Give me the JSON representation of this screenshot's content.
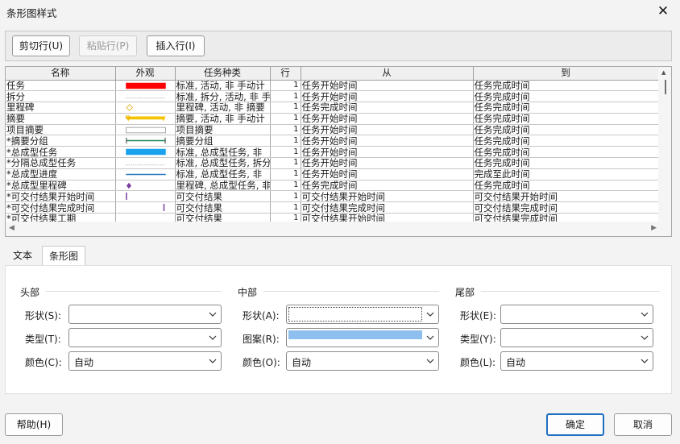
{
  "window": {
    "title": "条形图样式",
    "close_label": "✕"
  },
  "toolbar": {
    "cut_label": "剪切行(U)",
    "paste_label": "粘贴行(P)",
    "insert_label": "插入行(I)"
  },
  "grid": {
    "columns": [
      "名称",
      "外观",
      "任务种类",
      "行",
      "从",
      "到"
    ],
    "rows": [
      {
        "name": "任务",
        "appearance": "red-bar",
        "kind": "标准, 活动, 非 手动计",
        "row": "1",
        "from": "任务开始时间",
        "to": "任务完成时间"
      },
      {
        "name": "拆分",
        "appearance": "dotted-line",
        "kind": "标准, 拆分, 活动, 非 手",
        "row": "1",
        "from": "任务开始时间",
        "to": "任务完成时间"
      },
      {
        "name": "里程碑",
        "appearance": "diamond-outline",
        "kind": "里程碑, 活动, 非 摘要",
        "row": "1",
        "from": "任务完成时间",
        "to": "任务完成时间"
      },
      {
        "name": "摘要",
        "appearance": "yellow-summary",
        "kind": "摘要, 活动, 非 手动计",
        "row": "1",
        "from": "任务开始时间",
        "to": "任务完成时间"
      },
      {
        "name": "项目摘要",
        "appearance": "gray-outline-bar",
        "kind": "项目摘要",
        "row": "1",
        "from": "任务开始时间",
        "to": "任务完成时间"
      },
      {
        "name": "*摘要分组",
        "appearance": "green-bracket",
        "kind": "摘要分组",
        "row": "1",
        "from": "任务开始时间",
        "to": "任务完成时间"
      },
      {
        "name": "*总成型任务",
        "appearance": "blue-bar",
        "kind": "标准, 总成型任务, 非",
        "row": "1",
        "from": "任务开始时间",
        "to": "任务完成时间"
      },
      {
        "name": "*分隔总成型任务",
        "appearance": "dotted-line",
        "kind": "标准, 总成型任务, 拆分",
        "row": "1",
        "from": "任务开始时间",
        "to": "任务完成时间"
      },
      {
        "name": "*总成型进度",
        "appearance": "blue-line",
        "kind": "标准, 总成型任务, 非",
        "row": "1",
        "from": "任务开始时间",
        "to": "完成至此时间"
      },
      {
        "name": "*总成型里程碑",
        "appearance": "purple-diamond",
        "kind": "里程碑, 总成型任务, 非",
        "row": "1",
        "from": "任务完成时间",
        "to": "任务完成时间"
      },
      {
        "name": "*可交付结果开始时间",
        "appearance": "purple-start",
        "kind": "可交付结果",
        "row": "1",
        "from": "可交付结果开始时间",
        "to": "可交付结果开始时间"
      },
      {
        "name": "*可交付结果完成时间",
        "appearance": "purple-end",
        "kind": "可交付结果",
        "row": "1",
        "from": "可交付结果完成时间",
        "to": "可交付结果完成时间"
      },
      {
        "name": "*可交付结果工期",
        "appearance": "none",
        "kind": "可交付结果",
        "row": "1",
        "from": "可交付结果开始时间",
        "to": "可交付结果完成时间"
      }
    ]
  },
  "tabs": [
    {
      "label": "文本"
    },
    {
      "label": "条形图"
    }
  ],
  "bars_tab": {
    "head": {
      "title": "头部",
      "shape_label": "形状(S):",
      "type_label": "类型(T):",
      "color_label": "颜色(C):",
      "color_value": "自动"
    },
    "middle": {
      "title": "中部",
      "shape_label": "形状(A):",
      "pattern_label": "图案(R):",
      "color_label": "颜色(O):",
      "color_value": "自动",
      "pattern_color": "#8fbfee"
    },
    "tail": {
      "title": "尾部",
      "shape_label": "形状(E):",
      "type_label": "类型(Y):",
      "color_label": "颜色(L):",
      "color_value": "自动"
    }
  },
  "footer": {
    "help_label": "帮助(H)",
    "ok_label": "确定",
    "cancel_label": "取消"
  },
  "colors": {
    "accent": "#1f6fc0",
    "task_red": "#ff0000",
    "summary_yellow": "#f5c400",
    "rollup_blue": "#1aa3ec",
    "milestone_purple": "#7a3ea0",
    "group_green": "#1f8a5a"
  }
}
